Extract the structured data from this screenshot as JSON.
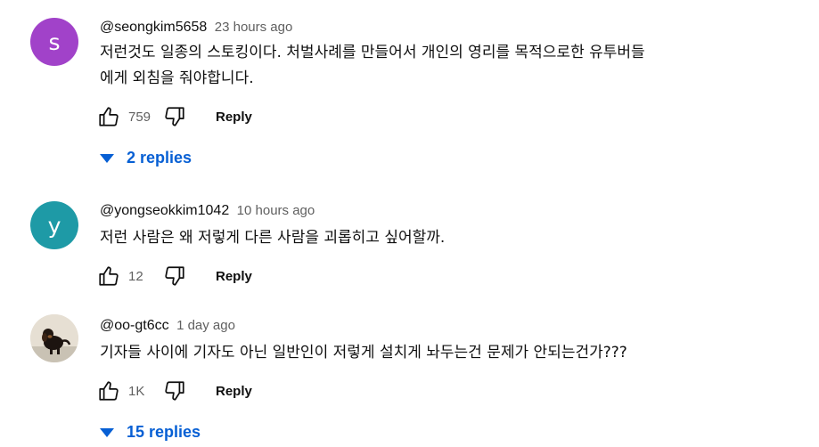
{
  "comments": [
    {
      "avatar_letter": "s",
      "avatar_color": "#a142c9",
      "author": "@seongkim5658",
      "time": "23 hours ago",
      "text_lines": [
        "저런것도 일종의 스토킹이다. 처벌사례를 만들어서 개인의 영리를 목적으로한 유투버들",
        "에게 외침을 줘야합니다."
      ],
      "likes": "759",
      "reply_label": "Reply",
      "replies_label": "2 replies"
    },
    {
      "avatar_letter": "y",
      "avatar_color": "#1e9aa6",
      "author": "@yongseokkim1042",
      "time": "10 hours ago",
      "text_lines": [
        "저런 사람은 왜 저렇게 다른 사람을 괴롭히고 싶어할까."
      ],
      "likes": "12",
      "reply_label": "Reply"
    },
    {
      "avatar_icon": "dog-photo-avatar",
      "author": "@oo-gt6cc",
      "time": "1 day ago",
      "text_lines": [
        "기자들 사이에 기자도 아닌 일반인이 저렇게 설치게 놔두는건 문제가 안되는건가???"
      ],
      "likes": "1K",
      "reply_label": "Reply",
      "replies_label": "15 replies"
    }
  ],
  "icons": {
    "like": "thumbs-up-icon",
    "dislike": "thumbs-down-icon",
    "expand": "caret-down-icon"
  },
  "colors": {
    "link": "#065fd4",
    "meta": "#606060"
  }
}
